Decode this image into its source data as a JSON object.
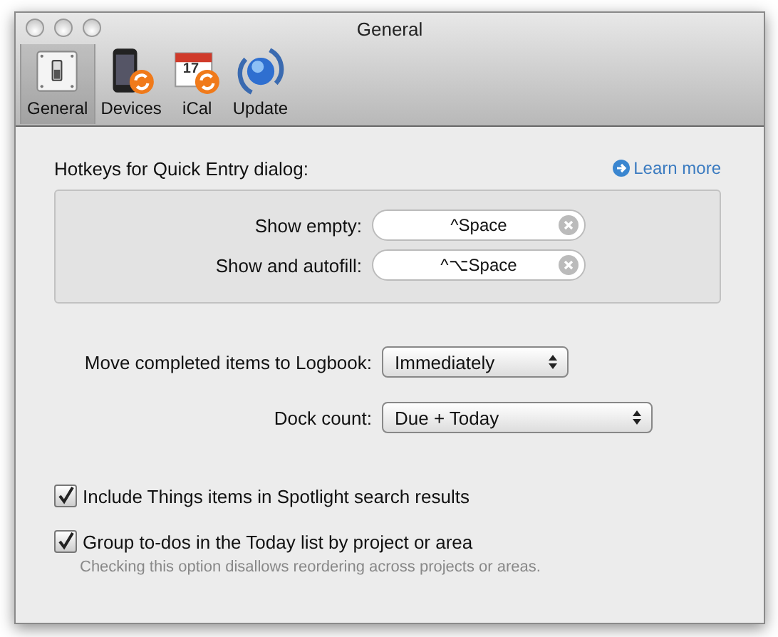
{
  "window": {
    "title": "General"
  },
  "toolbar": [
    {
      "label": "General",
      "kind": "switch",
      "selected": true
    },
    {
      "label": "Devices",
      "kind": "phone",
      "selected": false
    },
    {
      "label": "iCal",
      "kind": "calendar",
      "icon_text": "17",
      "selected": false
    },
    {
      "label": "Update",
      "kind": "globe",
      "selected": false
    }
  ],
  "hotkeys": {
    "heading": "Hotkeys for Quick Entry dialog:",
    "learn_more": "Learn more",
    "rows": [
      {
        "label": "Show empty:",
        "value": "^Space"
      },
      {
        "label": "Show and autofill:",
        "value": "^⌥Space"
      }
    ]
  },
  "popups": [
    {
      "label": "Move completed items to Logbook:",
      "value": "Immediately"
    },
    {
      "label": "Dock count:",
      "value": "Due + Today"
    }
  ],
  "checkboxes": [
    {
      "label": "Include Things items in Spotlight search results",
      "checked": true
    },
    {
      "label": "Group to-dos in the Today list by project or area",
      "checked": true,
      "note": "Checking this option disallows reordering across projects or areas."
    }
  ]
}
